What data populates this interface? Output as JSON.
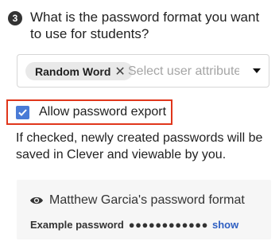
{
  "question": {
    "step": "3",
    "text": "What is the password format you want to use for students?"
  },
  "attributes": {
    "selected_chip": "Random Word",
    "remove_icon": "close-icon",
    "placeholder": "Select user attributes",
    "dropdown_icon": "caret-down-icon"
  },
  "export": {
    "checked": true,
    "label": "Allow password export",
    "help_text": "If checked, newly created passwords will be saved in Clever and viewable by you.",
    "highlight_color": "#e0361b",
    "checkbox_color": "#4a7bd6"
  },
  "preview": {
    "icon": "eye-icon",
    "title": "Matthew Garcia's password format",
    "example_label": "Example password",
    "example_value": "●●●●●●●●●●●●",
    "show_label": "show"
  }
}
